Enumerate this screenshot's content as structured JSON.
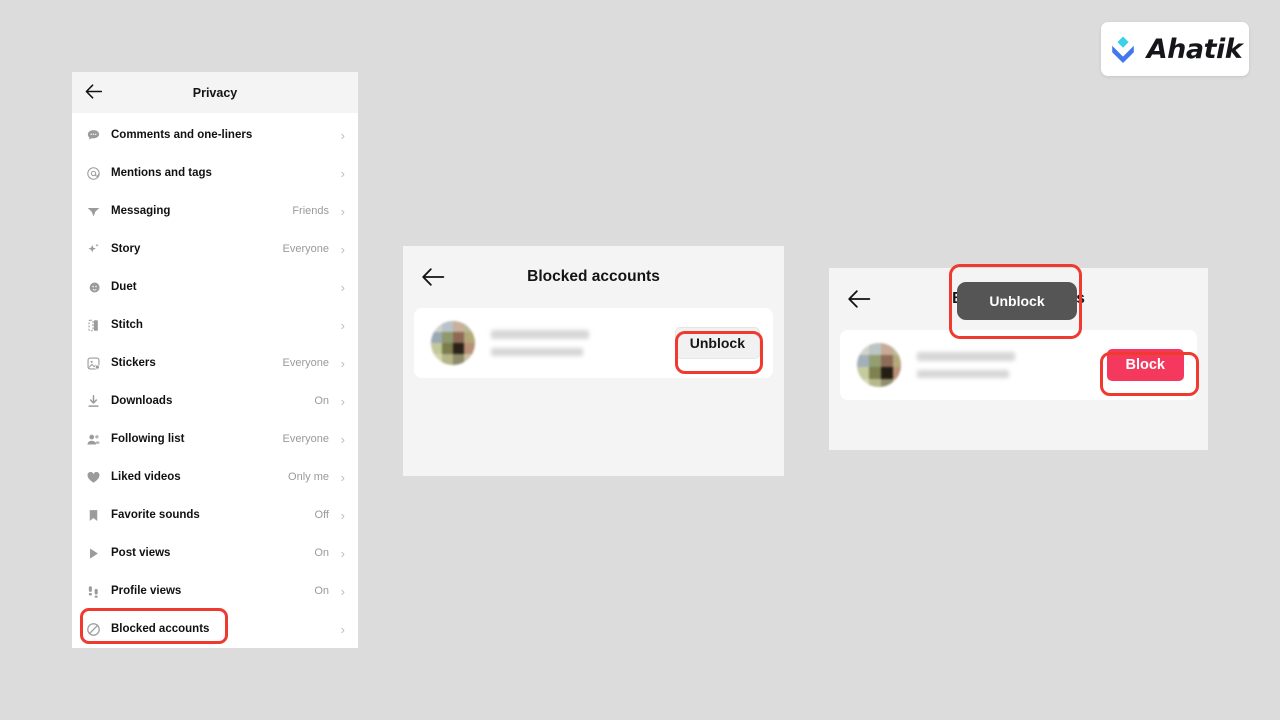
{
  "brand": {
    "name": "Ahatik",
    "mark_icon": "ahatik-chevron-logo",
    "mark_color_top": "#3dd0e8",
    "mark_color_bottom": "#3f78f0"
  },
  "background_color": "#dcdcdc",
  "highlight_color": "#f0392f",
  "privacy_panel": {
    "title": "Privacy",
    "back_icon": "back-arrow-icon",
    "items": [
      {
        "icon": "comment-bubble-icon",
        "label": "Comments and one-liners",
        "value": "",
        "chevron": "›"
      },
      {
        "icon": "at-mention-icon",
        "label": "Mentions and tags",
        "value": "",
        "chevron": "›"
      },
      {
        "icon": "paper-plane-icon",
        "label": "Messaging",
        "value": "Friends",
        "chevron": "›"
      },
      {
        "icon": "sparkle-icon",
        "label": "Story",
        "value": "Everyone",
        "chevron": "›"
      },
      {
        "icon": "duet-icon",
        "label": "Duet",
        "value": "",
        "chevron": "›"
      },
      {
        "icon": "stitch-icon",
        "label": "Stitch",
        "value": "",
        "chevron": "›"
      },
      {
        "icon": "sticker-icon",
        "label": "Stickers",
        "value": "Everyone",
        "chevron": "›"
      },
      {
        "icon": "download-icon",
        "label": "Downloads",
        "value": "On",
        "chevron": "›"
      },
      {
        "icon": "people-icon",
        "label": "Following list",
        "value": "Everyone",
        "chevron": "›"
      },
      {
        "icon": "heart-icon",
        "label": "Liked videos",
        "value": "Only me",
        "chevron": "›"
      },
      {
        "icon": "bookmark-icon",
        "label": "Favorite sounds",
        "value": "Off",
        "chevron": "›"
      },
      {
        "icon": "play-triangle-icon",
        "label": "Post views",
        "value": "On",
        "chevron": "›"
      },
      {
        "icon": "footsteps-icon",
        "label": "Profile views",
        "value": "On",
        "chevron": "›"
      },
      {
        "icon": "block-circle-icon",
        "label": "Blocked accounts",
        "value": "",
        "chevron": "›"
      }
    ]
  },
  "blocked_panel": {
    "title": "Blocked accounts",
    "back_icon": "back-arrow-icon",
    "account": {
      "avatar": "blurred-profile-photo",
      "name_redacted": "",
      "handle_redacted": ""
    },
    "action_label": "Unblock"
  },
  "unblocked_panel": {
    "title": "Blocked accounts",
    "back_icon": "back-arrow-icon",
    "toast_label": "Unblock",
    "account": {
      "avatar": "blurred-profile-photo",
      "name_redacted": "",
      "handle_redacted": ""
    },
    "action_label": "Block"
  }
}
